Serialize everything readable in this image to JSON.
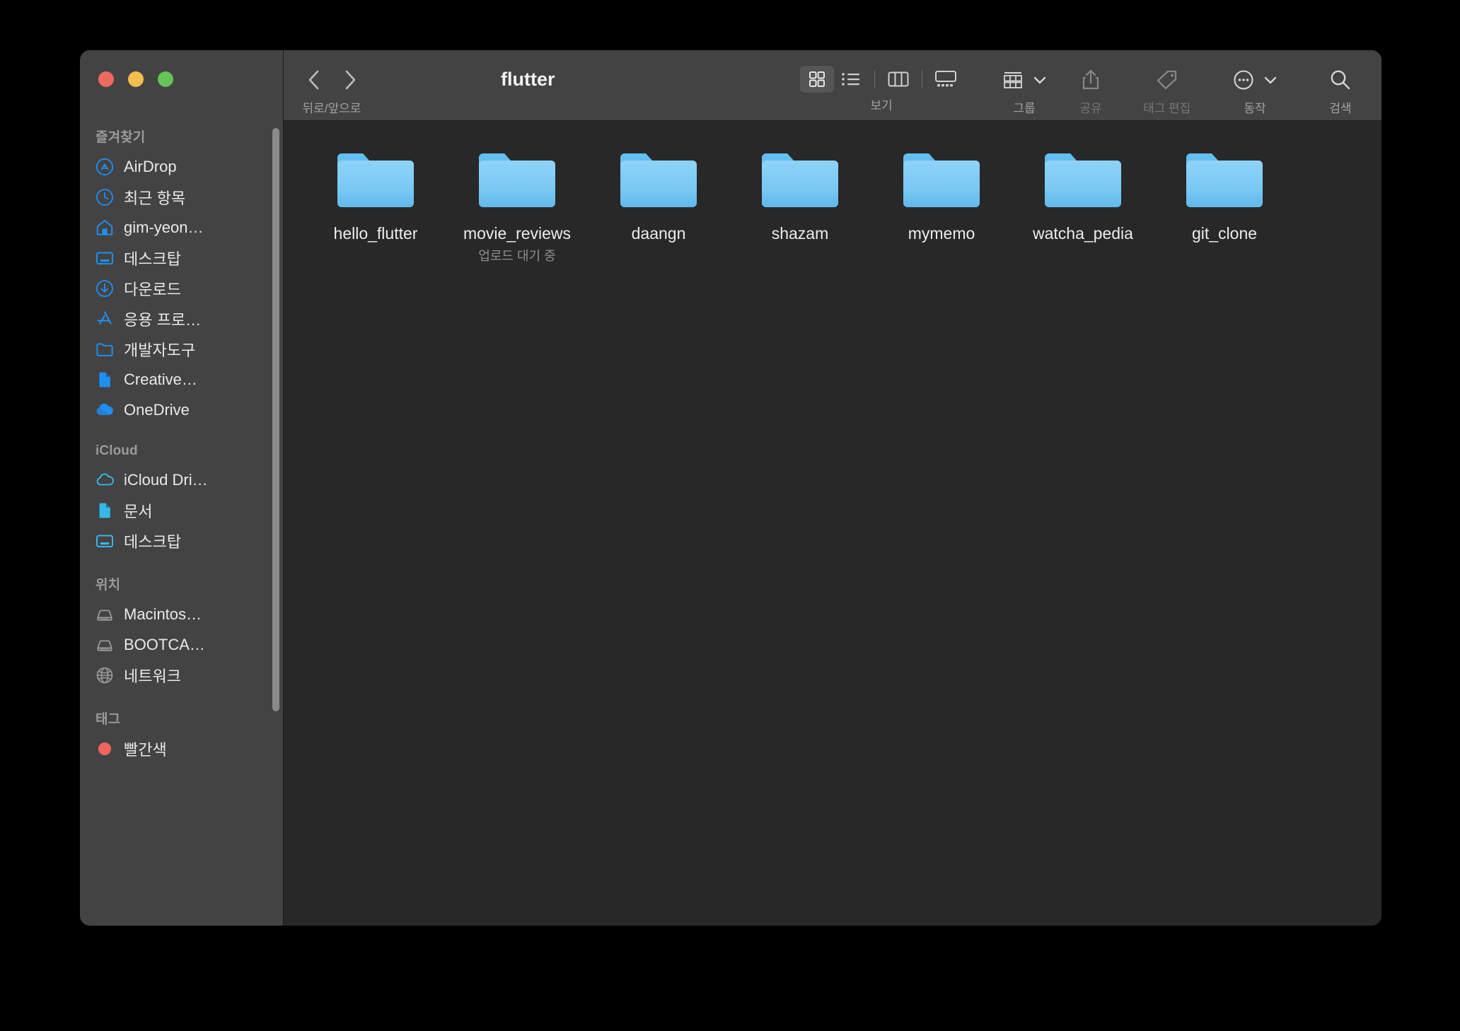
{
  "window": {
    "title": "flutter",
    "traffic_lights": [
      {
        "name": "close",
        "color": "#ec6a5f"
      },
      {
        "name": "minimize",
        "color": "#f2be4d"
      },
      {
        "name": "zoom",
        "color": "#62c554"
      }
    ]
  },
  "toolbar": {
    "nav_caption": "뒤로/앞으로",
    "back_icon": "chevron-left-icon",
    "forward_icon": "chevron-right-icon",
    "view_caption": "보기",
    "view_modes": [
      {
        "id": "icon",
        "icon": "grid-view-icon",
        "selected": true
      },
      {
        "id": "list",
        "icon": "list-view-icon",
        "selected": false
      },
      {
        "id": "column",
        "icon": "column-view-icon",
        "selected": false
      },
      {
        "id": "gallery",
        "icon": "gallery-view-icon",
        "selected": false
      }
    ],
    "group_caption": "그룹",
    "group_icon": "group-by-icon",
    "share_caption": "공유",
    "share_icon": "share-icon",
    "share_disabled": true,
    "tag_caption": "태그 편집",
    "tag_icon": "tag-icon",
    "tag_disabled": true,
    "action_caption": "동작",
    "action_icon": "ellipsis-circle-icon",
    "search_caption": "검색",
    "search_icon": "search-icon",
    "chevron_icon": "chevron-down-icon"
  },
  "sidebar": {
    "sections": [
      {
        "title": "즐겨찾기",
        "items": [
          {
            "label": "AirDrop",
            "icon": "airdrop-icon",
            "color": "#1e90f5"
          },
          {
            "label": "최근 항목",
            "icon": "clock-icon",
            "color": "#1e90f5"
          },
          {
            "label": "gim-yeon…",
            "icon": "home-icon",
            "color": "#1e90f5"
          },
          {
            "label": "데스크탑",
            "icon": "desktop-icon",
            "color": "#1e90f5"
          },
          {
            "label": "다운로드",
            "icon": "download-icon",
            "color": "#1e90f5"
          },
          {
            "label": "응용 프로…",
            "icon": "applications-icon",
            "color": "#1e90f5"
          },
          {
            "label": "개발자도구",
            "icon": "folder-icon",
            "color": "#1e90f5"
          },
          {
            "label": "Creative…",
            "icon": "document-icon",
            "color": "#1e90f5"
          },
          {
            "label": "OneDrive",
            "icon": "cloud-icon",
            "color": "#1e90f5"
          }
        ]
      },
      {
        "title": "iCloud",
        "items": [
          {
            "label": "iCloud Dri…",
            "icon": "icloud-icon",
            "color": "#35b8ea"
          },
          {
            "label": "문서",
            "icon": "document-icon",
            "color": "#35b8ea"
          },
          {
            "label": "데스크탑",
            "icon": "desktop-icon",
            "color": "#35b8ea"
          }
        ]
      },
      {
        "title": "위치",
        "items": [
          {
            "label": "Macintos…",
            "icon": "harddisk-icon",
            "color": "#9a9a9a"
          },
          {
            "label": "BOOTCA…",
            "icon": "harddisk-icon",
            "color": "#9a9a9a"
          },
          {
            "label": "네트워크",
            "icon": "network-globe-icon",
            "color": "#9a9a9a"
          }
        ]
      },
      {
        "title": "태그",
        "items": [
          {
            "label": "빨간색",
            "icon": "tag-dot-icon",
            "color": "#f2655c"
          }
        ]
      }
    ]
  },
  "content": {
    "files": [
      {
        "name": "hello_flutter",
        "icon": "folder-icon",
        "subtitle": ""
      },
      {
        "name": "movie_reviews",
        "icon": "folder-icon",
        "subtitle": "업로드 대기 중"
      },
      {
        "name": "daangn",
        "icon": "folder-icon",
        "subtitle": ""
      },
      {
        "name": "shazam",
        "icon": "folder-icon",
        "subtitle": ""
      },
      {
        "name": "mymemo",
        "icon": "folder-icon",
        "subtitle": ""
      },
      {
        "name": "watcha_pedia",
        "icon": "folder-icon",
        "subtitle": ""
      },
      {
        "name": "git_clone",
        "icon": "folder-icon",
        "subtitle": ""
      }
    ]
  },
  "colors": {
    "folder_light": "#7ecbf5",
    "folder_dark": "#4fb3ee",
    "sidebar_bg": "#434343",
    "content_bg": "#282828",
    "accent": "#1e90f5"
  }
}
